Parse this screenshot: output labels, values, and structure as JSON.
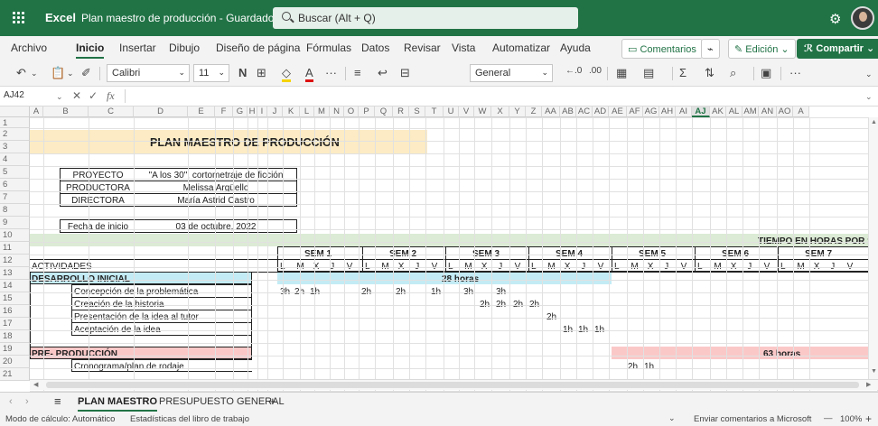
{
  "titlebar": {
    "app": "Excel",
    "doc_title": "Plan maestro de producción - Guardado ∨",
    "search_placeholder": "Buscar (Alt + Q)"
  },
  "menu": {
    "items": [
      "Archivo",
      "Inicio",
      "Insertar",
      "Dibujo",
      "Diseño de página",
      "Fórmulas",
      "Datos",
      "Revisar",
      "Vista",
      "Automatizar",
      "Ayuda"
    ],
    "active": "Inicio",
    "comments_label": "Comentarios",
    "edit_label": "Edición",
    "share_label": "Compartir"
  },
  "ribbon": {
    "font_name": "Calibri",
    "font_size": "11",
    "bold": "N",
    "number_format": "General",
    "more": "···"
  },
  "formula_bar": {
    "name_box": "AJ42",
    "fx": "fx",
    "value": ""
  },
  "columns": {
    "letters": [
      "A",
      "B",
      "C",
      "D",
      "E",
      "F",
      "G",
      "H",
      "I",
      "J",
      "K",
      "L",
      "M",
      "N",
      "O",
      "P",
      "Q",
      "R",
      "S",
      "T",
      "U",
      "V",
      "W",
      "X",
      "Y",
      "Z",
      "AA",
      "AB",
      "AC",
      "AD",
      "AE",
      "AF",
      "AG",
      "AH",
      "AI",
      "AJ",
      "AK",
      "AL",
      "AM",
      "AN",
      "AO",
      "A"
    ],
    "selected": "AJ"
  },
  "rows": [
    "1",
    "2",
    "3",
    "4",
    "5",
    "6",
    "7",
    "8",
    "9",
    "10",
    "11",
    "12",
    "13",
    "14",
    "15",
    "16",
    "17",
    "18",
    "19",
    "20",
    "21"
  ],
  "sheet": {
    "title": "PLAN MAESTRO DE PRODUCCIÓN",
    "info": [
      {
        "label": "PROYECTO",
        "value": "\"A los 30\", cortometraje de ficción"
      },
      {
        "label": "PRODUCTORA",
        "value": "Melissa Argüello"
      },
      {
        "label": "DIRECTORA",
        "value": "María Astrid Castro"
      }
    ],
    "start_label": "Fecha de inicio",
    "start_value": "03 de octubre, 2022",
    "time_header": "TIEMPO EN HORAS POR SEMA",
    "weeks": [
      "SEM 1",
      "SEM 2",
      "SEM 3",
      "SEM 4",
      "SEM 5",
      "SEM 6",
      "SEM 7"
    ],
    "days": [
      "L",
      "M",
      "X",
      "J",
      "V"
    ],
    "activities_label": "ACTIVIDADES",
    "phase1": {
      "name": "DESARROLLO INICIAL",
      "total": "28 horas"
    },
    "phase1_tasks": [
      {
        "name": "Concepción de la problemática",
        "hours": [
          "3h",
          "2h",
          "1h",
          "2h",
          "2h",
          "1h",
          "3h",
          "3h"
        ]
      },
      {
        "name": "Creación de la historia",
        "hours": [
          "2h",
          "2h",
          "2h",
          "2h"
        ]
      },
      {
        "name": "Presentación de la idea al tutor",
        "hours": [
          "2h"
        ]
      },
      {
        "name": "Aceptación de la idea",
        "hours": [
          "1h",
          "1h",
          "1h"
        ]
      }
    ],
    "phase2": {
      "name": "PRE- PRODUCCIÓN",
      "total": "63 horas"
    },
    "phase2_tasks": [
      {
        "name": "Cronograma/plan de rodaje",
        "hours": [
          "2h",
          "1h"
        ]
      }
    ]
  },
  "sheets": {
    "tabs": [
      "PLAN MAESTRO",
      "PRESUPUESTO GENERAL"
    ],
    "active": "PLAN MAESTRO",
    "add": "+"
  },
  "status": {
    "calc_mode": "Modo de cálculo: Automático",
    "stats": "Estadísticas del libro de trabajo",
    "feedback": "Enviar comentarios a Microsoft",
    "zoom": "100%"
  },
  "colors": {
    "brand": "#217346",
    "title_fill": "#fcebc4",
    "phase1_fill": "#c3ebf5",
    "phase2_fill": "#fbc8c8",
    "time_band": "#dcebd5"
  }
}
